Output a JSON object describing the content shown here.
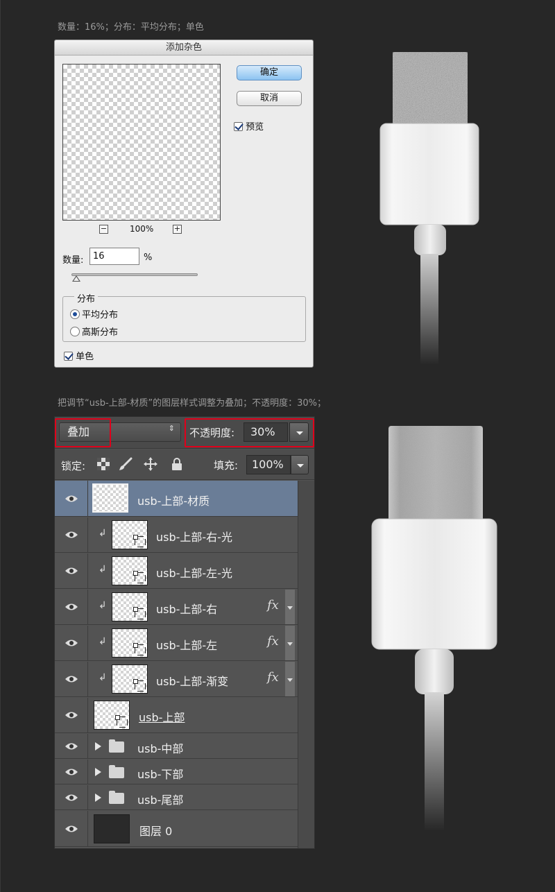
{
  "captions": {
    "top": "数量：16%；分布：平均分布；单色",
    "middle": "把调节“usb-上部-材质”的图层样式调整为叠加；不透明度：30%；"
  },
  "dialog": {
    "title": "添加杂色",
    "ok": "确定",
    "cancel": "取消",
    "preview_label": "预览",
    "zoom": "100%",
    "zoom_out": "−",
    "zoom_in": "+",
    "amount_label": "数量:",
    "amount_value": "16",
    "amount_unit": "%",
    "amount_slider_percent": 16,
    "distribution_label": "分布",
    "dist_uniform": "平均分布",
    "dist_gaussian": "高斯分布",
    "dist_selected": "平均分布",
    "mono_label": "单色"
  },
  "layers_panel": {
    "blend_mode": "叠加",
    "blend_arrows": "⇕",
    "opacity_label": "不透明度:",
    "opacity_value": "30%",
    "lock_label": "锁定:",
    "fill_label": "填充:",
    "fill_value": "100%",
    "fx_symbol": "fx",
    "clip_symbol": "↲",
    "layers": [
      {
        "name": "usb-上部-材质"
      },
      {
        "name": "usb-上部-右-光"
      },
      {
        "name": "usb-上部-左-光"
      },
      {
        "name": "usb-上部-右"
      },
      {
        "name": "usb-上部-左"
      },
      {
        "name": "usb-上部-渐变"
      },
      {
        "name": "usb-上部"
      },
      {
        "name": "usb-中部"
      },
      {
        "name": "usb-下部"
      },
      {
        "name": "usb-尾部"
      },
      {
        "name": "图层 0"
      }
    ]
  },
  "colors": {
    "background": "#272727",
    "highlight_box": "#e0001a",
    "selected_layer": "#6a7d97"
  }
}
